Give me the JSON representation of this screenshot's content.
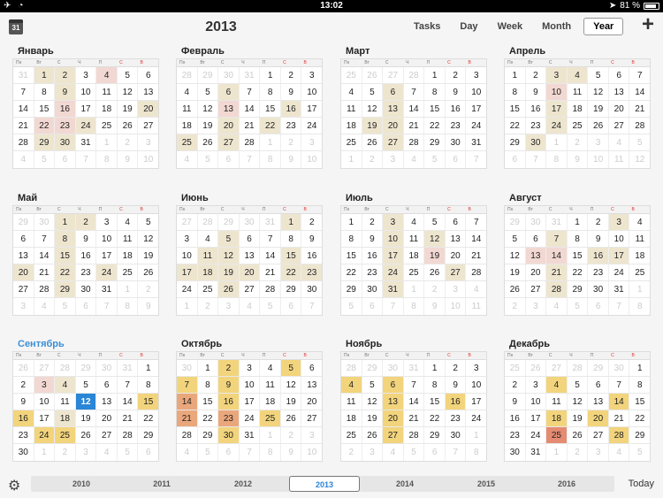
{
  "status_bar": {
    "time": "13:02",
    "battery": "81 %"
  },
  "toolbar": {
    "year": "2013",
    "cal_icon_text": "31",
    "tabs": [
      "Tasks",
      "Day",
      "Week",
      "Month",
      "Year"
    ],
    "active_tab": "Year",
    "add_label": "+"
  },
  "weekday_labels": [
    "Пн",
    "Вт",
    "С",
    "Ч",
    "П",
    "С",
    "В"
  ],
  "months": [
    {
      "name": "Январь",
      "start": 2,
      "days": 31,
      "hl": {
        "1": 1,
        "2": 1,
        "4": 2,
        "9": 1,
        "16": 2,
        "20": 1,
        "22": 2,
        "23": 2,
        "24": 1,
        "29": 1,
        "30": 1
      }
    },
    {
      "name": "Февраль",
      "start": 5,
      "days": 28,
      "hl": {
        "6": 1,
        "13": 2,
        "16": 1,
        "20": 1,
        "22": 1,
        "25": 1,
        "27": 1
      }
    },
    {
      "name": "Март",
      "start": 5,
      "days": 31,
      "hl": {
        "6": 1,
        "13": 1,
        "19": 1,
        "20": 1,
        "27": 1
      }
    },
    {
      "name": "Апрель",
      "start": 1,
      "days": 30,
      "hl": {
        "3": 1,
        "4": 1,
        "10": 2,
        "17": 1,
        "24": 1,
        "30": 1
      }
    },
    {
      "name": "Май",
      "start": 3,
      "days": 31,
      "hl": {
        "1": 1,
        "2": 1,
        "8": 1,
        "15": 1,
        "20": 1,
        "22": 1,
        "24": 1,
        "29": 1
      }
    },
    {
      "name": "Июнь",
      "start": 6,
      "days": 30,
      "hl": {
        "1": 1,
        "5": 1,
        "11": 1,
        "12": 1,
        "15": 1,
        "17": 1,
        "18": 1,
        "19": 1,
        "20": 1,
        "22": 1,
        "23": 1,
        "26": 1
      }
    },
    {
      "name": "Июль",
      "start": 1,
      "days": 31,
      "hl": {
        "3": 1,
        "10": 1,
        "12": 1,
        "17": 1,
        "19": 2,
        "24": 1,
        "27": 1,
        "31": 1
      }
    },
    {
      "name": "Август",
      "start": 4,
      "days": 31,
      "hl": {
        "3": 1,
        "7": 1,
        "13": 2,
        "14": 2,
        "16": 1,
        "17": 1,
        "21": 1,
        "28": 1
      }
    },
    {
      "name": "Сентябрь",
      "start": 7,
      "days": 30,
      "current": true,
      "today": 12,
      "hl": {
        "3": 2,
        "4": 1,
        "15": 3,
        "16": 3,
        "18": 1,
        "24": 3,
        "25": 3
      }
    },
    {
      "name": "Октябрь",
      "start": 2,
      "days": 31,
      "hl": {
        "2": 3,
        "5": 3,
        "7": 3,
        "9": 3,
        "14": 4,
        "16": 3,
        "21": 4,
        "23": 4,
        "25": 3,
        "30": 3
      }
    },
    {
      "name": "Ноябрь",
      "start": 5,
      "days": 30,
      "hl": {
        "4": 3,
        "6": 3,
        "13": 3,
        "16": 3,
        "20": 3,
        "27": 3
      }
    },
    {
      "name": "Декабрь",
      "start": 7,
      "days": 31,
      "hl": {
        "4": 3,
        "14": 3,
        "18": 3,
        "20": 3,
        "25": 5,
        "28": 3
      }
    }
  ],
  "bottom_bar": {
    "years": [
      "2010",
      "2011",
      "2012",
      "2013",
      "2014",
      "2015",
      "2016"
    ],
    "active_year": "2013",
    "today_label": "Today"
  }
}
